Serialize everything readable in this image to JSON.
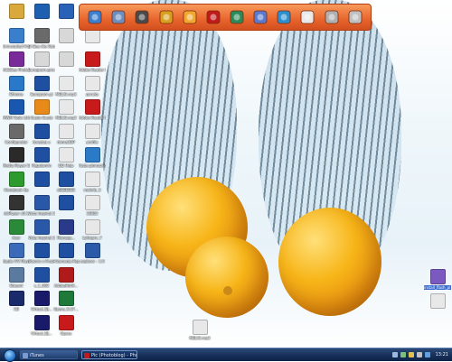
{
  "desktop": {
    "columns": [
      [
        {
          "name": "icon-c1-1",
          "label": "",
          "color": "#d9a93b"
        },
        {
          "name": "icon-c1-2",
          "label": "Uninstalled Programs",
          "color": "#3a7fcc"
        },
        {
          "name": "icon-c1-3",
          "label": "ACDSee Photo Editor",
          "color": "#7a2b9a"
        },
        {
          "name": "icon-c1-4",
          "label": "Ethoms",
          "color": "#2a78c8"
        },
        {
          "name": "icon-c1-5",
          "label": "MWM Tools Life",
          "color": "#1a58b0"
        },
        {
          "name": "icon-c1-6",
          "label": "Configurator",
          "color": "#6a6a6a"
        },
        {
          "name": "icon-c1-7",
          "label": "Media Player Classic",
          "color": "#2a2a2a"
        },
        {
          "name": "icon-c1-8",
          "label": "Honebook Xp",
          "color": "#2c9a2c"
        },
        {
          "name": "icon-c1-9",
          "label": "dxPlayer v0.1",
          "color": "#333333"
        },
        {
          "name": "icon-c1-10",
          "label": "Acer",
          "color": "#2a8a3a"
        },
        {
          "name": "icon-c1-11",
          "label": "Apple iTV Player",
          "color": "#3a6ab8"
        },
        {
          "name": "icon-c1-12",
          "label": "Eduard",
          "color": "#5a7aa0"
        },
        {
          "name": "icon-c1-13",
          "label": "CB",
          "color": "#1a2a6a"
        }
      ],
      [
        {
          "name": "icon-c2-1",
          "label": "",
          "color": "#1f5fb0"
        },
        {
          "name": "icon-c2-2",
          "label": "Gi Bee Ale Retrospective 13",
          "color": "#6a6a6a"
        },
        {
          "name": "icon-c2-3",
          "label": "Eurogram.gmx",
          "color": "#d8d8d8"
        },
        {
          "name": "icon-c2-4",
          "label": "Eurogram.gl",
          "color": "#1f4fa0"
        },
        {
          "name": "icon-c2-5",
          "label": "Gusto Gusto",
          "color": "#e88a1a"
        },
        {
          "name": "icon-c2-6",
          "label": "Izvestaj u",
          "color": "#1f4fa0"
        },
        {
          "name": "icon-c2-7",
          "label": "Regulamin",
          "color": "#1f4fa0"
        },
        {
          "name": "icon-c2-8",
          "label": "",
          "color": "#1f4fa0"
        },
        {
          "name": "icon-c2-9",
          "label": "Vista Inspirat 2 Config",
          "color": "#2a58a8"
        },
        {
          "name": "icon-c2-10",
          "label": "Vista Inspirat 2 Help",
          "color": "#2a58a8"
        },
        {
          "name": "icon-c2-11",
          "label": "Raoniv o Prazi",
          "color": "#1f4fa0"
        },
        {
          "name": "icon-c2-12",
          "label": "s_1_002",
          "color": "#1f4fa0"
        },
        {
          "name": "icon-c2-13",
          "label": "Virtual_DJ...",
          "color": "#1a1a6a"
        },
        {
          "name": "icon-c2-14",
          "label": "Virtual_DJ...",
          "color": "#1a1a6a"
        }
      ],
      [
        {
          "name": "icon-c3-1",
          "label": "",
          "color": "#2a62b8"
        },
        {
          "name": "icon-c3-2",
          "label": "",
          "color": "#d8d8d8"
        },
        {
          "name": "icon-c3-3",
          "label": "",
          "color": "#d8d8d8"
        },
        {
          "name": "icon-c3-4",
          "label": "MBLIG.mp3",
          "color": "#e8e8e8"
        },
        {
          "name": "icon-c3-5",
          "label": "MBLIG.mp3",
          "color": "#e8e8e8"
        },
        {
          "name": "icon-c3-6",
          "label": "doma3DP",
          "color": "#e8e8e8"
        },
        {
          "name": "icon-c3-7",
          "label": "DD Help",
          "color": "#e8e8e8"
        },
        {
          "name": "icon-c3-8",
          "label": "sEEEEEEE",
          "color": "#1f4fa0"
        },
        {
          "name": "icon-c3-9",
          "label": "",
          "color": "#1f4fa0"
        },
        {
          "name": "icon-c3-10",
          "label": "Planopp...",
          "color": "#2a3a8a"
        },
        {
          "name": "icon-c3-11",
          "label": "~Gamenja Republike",
          "color": "#1f4fa0"
        },
        {
          "name": "icon-c3-12",
          "label": "AdobeRdr9...",
          "color": "#b01a1a"
        },
        {
          "name": "icon-c3-13",
          "label": "Opera_9.27...",
          "color": "#1f7a3a"
        },
        {
          "name": "icon-c3-14",
          "label": "Opera",
          "color": "#c81a1a"
        }
      ],
      [
        {
          "name": "icon-c4-1",
          "label": "",
          "color": "#c01a1a"
        },
        {
          "name": "icon-c4-2",
          "label": "",
          "color": "#e8e8e8"
        },
        {
          "name": "icon-c4-3",
          "label": "Adobe Reader 8",
          "color": "#c81a1a"
        },
        {
          "name": "icon-c4-4",
          "label": "poruka",
          "color": "#e8e8e8"
        },
        {
          "name": "icon-c4-5",
          "label": "Adobe Reader 8",
          "color": "#c81a1a"
        },
        {
          "name": "icon-c4-6",
          "label": "profile",
          "color": "#e8e8e8"
        },
        {
          "name": "icon-c4-7",
          "label": "Tasty gimnazijcew",
          "color": "#2a7ac8"
        },
        {
          "name": "icon-c4-8",
          "label": "mokrib_3",
          "color": "#e8e8e8"
        },
        {
          "name": "icon-c4-9",
          "label": "33852",
          "color": "#e8e8e8"
        },
        {
          "name": "icon-c4-10",
          "label": "Lofroprv_7",
          "color": "#e8e8e8"
        },
        {
          "name": "icon-c4-11",
          "label": "explorer - 1.0",
          "color": "#2a5aa8"
        }
      ]
    ],
    "lone_icon": {
      "name": "icon-centre",
      "label": "MBLIG.mp3",
      "color": "#e8e8e8"
    },
    "right_icons": [
      {
        "name": "icon-right-1",
        "label": "install_flash_pl ayer",
        "color": "#7a5ac0",
        "selected": true
      },
      {
        "name": "icon-right-2",
        "label": "",
        "color": "#e8e8e8"
      }
    ]
  },
  "dock": {
    "items": [
      {
        "name": "dock-computer-icon",
        "color": "#3a7fd0"
      },
      {
        "name": "dock-network-icon",
        "color": "#6a8fc0"
      },
      {
        "name": "dock-hammer-icon",
        "color": "#4a4a4a"
      },
      {
        "name": "dock-palette-icon",
        "color": "#d8a020"
      },
      {
        "name": "dock-media-icon",
        "color": "#f0a830"
      },
      {
        "name": "dock-vinyl-icon",
        "color": "#c01a1a"
      },
      {
        "name": "dock-book-icon",
        "color": "#2a8a5a"
      },
      {
        "name": "dock-music-icon",
        "color": "#5a7ad0"
      },
      {
        "name": "dock-globe-icon",
        "color": "#2a90d0"
      },
      {
        "name": "dock-clock-icon",
        "color": "#e8e8e8"
      },
      {
        "name": "dock-gear-icon",
        "color": "#b0b0b0"
      },
      {
        "name": "dock-recycle-icon",
        "color": "#c0c0c0"
      }
    ]
  },
  "taskbar": {
    "buttons": [
      {
        "name": "taskbar-itunes",
        "label": "iTunes",
        "color": "#7a9ad0",
        "active": false
      },
      {
        "name": "taskbar-photoshop",
        "label": "Pic (Photoblog) - Photo...",
        "color": "#c01a1a",
        "active": true
      }
    ],
    "clock": "13:21"
  }
}
